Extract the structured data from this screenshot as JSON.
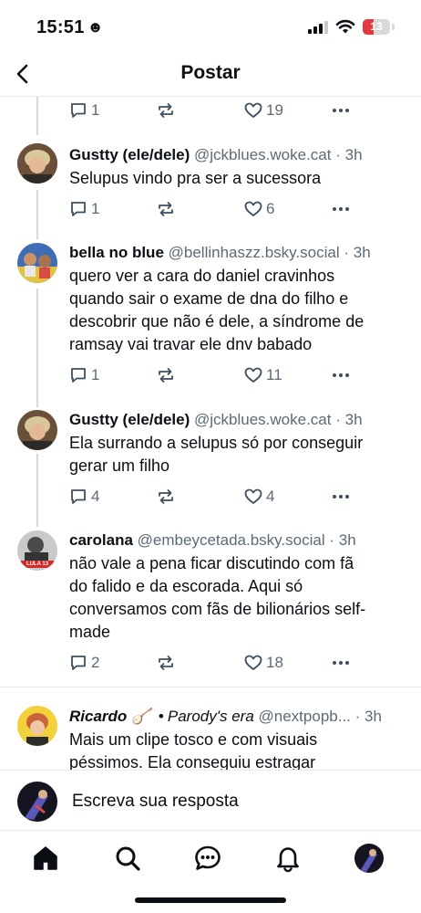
{
  "status": {
    "time": "15:51",
    "time_icon": "☻",
    "battery": "13"
  },
  "header": {
    "title": "Postar"
  },
  "top_actions": {
    "replies": "1",
    "likes": "19"
  },
  "posts": [
    {
      "name": "Gustty (ele/dele)",
      "handle": "@jckblues.woke.cat",
      "time": "3h",
      "text": [
        "Selupus vindo pra ser a sucessora"
      ],
      "replies": "1",
      "likes": "6"
    },
    {
      "name": "bella no blue",
      "handle": "@bellinhaszz.bsky.social",
      "time": "3h",
      "text": [
        "quero ver a cara do daniel cravinhos",
        "quando sair o exame de dna do filho e",
        "descobrir que não é dele, a síndrome de",
        "ramsay vai travar ele dnv babado"
      ],
      "replies": "1",
      "likes": "11"
    },
    {
      "name": "Gustty (ele/dele)",
      "handle": "@jckblues.woke.cat",
      "time": "3h",
      "text": [
        "Ela surrando a selupus só por conseguir",
        "gerar um filho"
      ],
      "replies": "4",
      "likes": "4"
    },
    {
      "name": "carolana",
      "handle": "@embeycetada.bsky.social",
      "time": "3h",
      "text": [
        "não vale a pena ficar discutindo com fã",
        "do falido e da escorada. Aqui só",
        "conversamos com fãs de bilionários self-",
        "made"
      ],
      "replies": "2",
      "likes": "18",
      "avatar_badge": "LULA 13"
    },
    {
      "name": "Ricardo 🪕",
      "bullet": "•",
      "label": "Parody's era",
      "handle": "@nextpopb...",
      "time": "3h",
      "text": [
        "Mais um clipe tosco e com visuais",
        "péssimos. Ela conseguiu estragar"
      ]
    }
  ],
  "reply": {
    "placeholder": "Escreva sua resposta"
  },
  "tabs": [
    "home-icon",
    "search-icon",
    "chat-icon",
    "bell-icon",
    "profile-avatar"
  ],
  "colors": {
    "text": "#0b0f14",
    "muted": "#5c6a78",
    "icon": "#3d4e5e",
    "divider": "#e8ebef",
    "thread_line": "#d4d9df",
    "battery_low": "#e0393e"
  }
}
